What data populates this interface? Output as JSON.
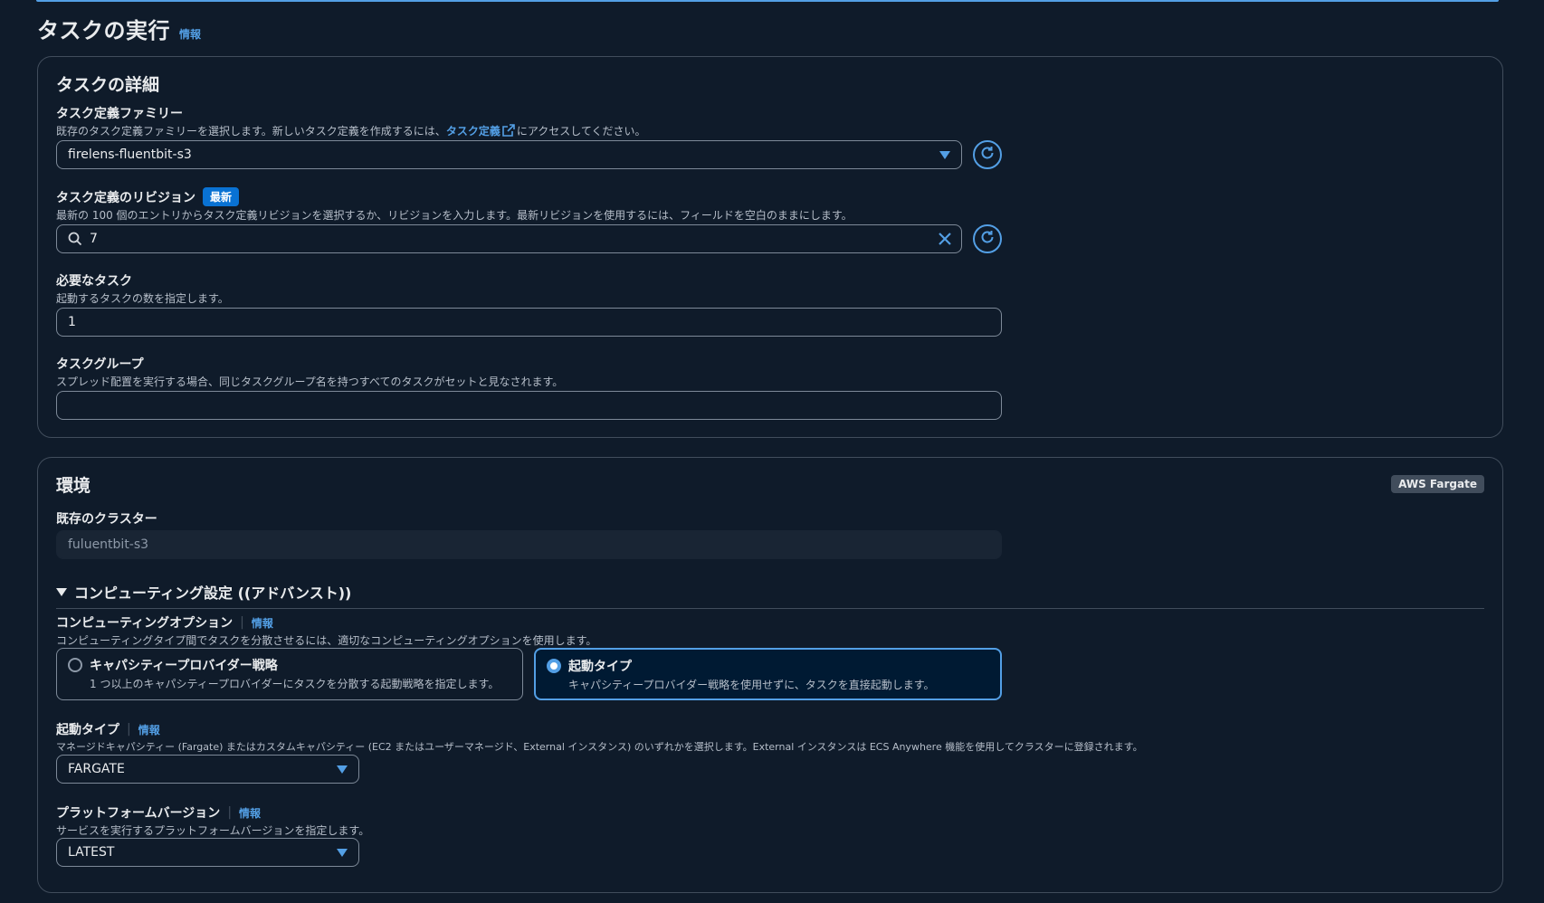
{
  "page": {
    "title": "タスクの実行",
    "info": "情報"
  },
  "details": {
    "title": "タスクの詳細",
    "family": {
      "label": "タスク定義ファミリー",
      "desc_pre": "既存のタスク定義ファミリーを選択します。新しいタスク定義を作成するには、",
      "desc_link": "タスク定義",
      "desc_post": "にアクセスしてください。",
      "value": "firelens-fluentbit-s3"
    },
    "revision": {
      "label": "タスク定義のリビジョン",
      "badge": "最新",
      "desc": "最新の 100 個のエントリからタスク定義リビジョンを選択するか、リビジョンを入力します。最新リビジョンを使用するには、フィールドを空白のままにします。",
      "value": "7"
    },
    "tasks": {
      "label": "必要なタスク",
      "desc": "起動するタスクの数を指定します。",
      "value": "1"
    },
    "group": {
      "label": "タスクグループ",
      "desc": "スプレッド配置を実行する場合、同じタスクグループ名を持つすべてのタスクがセットと見なされます。",
      "value": ""
    }
  },
  "env": {
    "title": "環境",
    "badge": "AWS Fargate",
    "cluster": {
      "label": "既存のクラスター",
      "value": "fuluentbit-s3"
    },
    "compute_section": "コンピューティング設定 ((アドバンスト))",
    "compute_option": {
      "label": "コンピューティングオプション",
      "info": "情報",
      "desc": "コンピューティングタイプ間でタスクを分散させるには、適切なコンピューティングオプションを使用します。",
      "options": [
        {
          "title": "キャパシティープロバイダー戦略",
          "desc": "1 つ以上のキャパシティープロバイダーにタスクを分散する起動戦略を指定します。"
        },
        {
          "title": "起動タイプ",
          "desc": "キャパシティープロバイダー戦略を使用せずに、タスクを直接起動します。"
        }
      ],
      "selected": "起動タイプ"
    },
    "launch_type": {
      "label": "起動タイプ",
      "info": "情報",
      "desc": "マネージドキャパシティー (Fargate) またはカスタムキャパシティー (EC2 またはユーザーマネージド、External インスタンス) のいずれかを選択します。External インスタンスは ECS Anywhere 機能を使用してクラスターに登録されます。",
      "value": "FARGATE"
    },
    "platform": {
      "label": "プラットフォームバージョン",
      "info": "情報",
      "desc": "サービスを実行するプラットフォームバージョンを指定します。",
      "value": "LATEST"
    }
  },
  "colors": {
    "accent": "#539fe5",
    "background": "#0f1b2a",
    "border": "#414d5c",
    "badge_new": "#0972d3"
  },
  "icons": [
    "external-link-icon",
    "refresh-icon",
    "search-icon",
    "clear-icon",
    "caret-down-icon",
    "expand-triangle-icon"
  ]
}
